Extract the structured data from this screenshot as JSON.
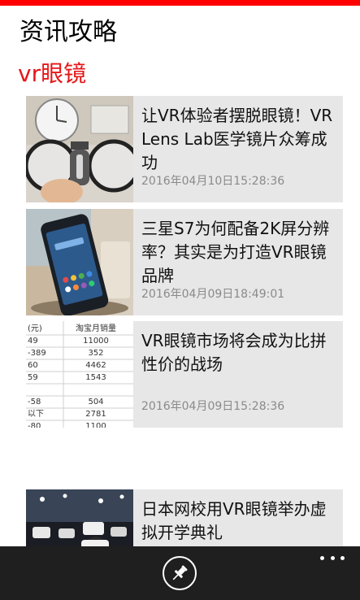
{
  "app": {
    "title": "资讯攻略"
  },
  "section": {
    "title": "vr眼镜"
  },
  "articles": [
    {
      "headline": "让VR体验者摆脱眼镜！VR Lens Lab医学镜片众筹成功",
      "time": "2016年04月10日15:28:36",
      "image": "glasses-lens-photo"
    },
    {
      "headline": "三星S7为何配备2K屏分辨率？其实是为打造VR眼镜品牌",
      "time": "2016年04月09日18:49:01",
      "image": "samsung-phone-photo"
    },
    {
      "headline": "VR眼镜市场将会成为比拼性价的战场",
      "time": "2016年04月09日15:28:36",
      "image": "sales-table-photo",
      "table": {
        "headers": [
          "(元)",
          "淘宝月销量"
        ],
        "rows": [
          [
            "49",
            "11000"
          ],
          [
            "-389",
            "352"
          ],
          [
            "60",
            "4462"
          ],
          [
            "59",
            "1543"
          ],
          [
            "",
            ""
          ],
          [
            "-58",
            "504"
          ],
          [
            "以下",
            "2781"
          ],
          [
            "-80",
            "1100"
          ]
        ]
      }
    },
    {
      "headline": "日本网校用VR眼镜举办虚拟开学典礼",
      "time": "",
      "image": "vr-ceremony-photo"
    }
  ],
  "appbar": {
    "pin_icon": "pin-icon",
    "more_icon": "more-dots-icon"
  },
  "colors": {
    "accent": "#ff0000",
    "section_title": "#e5171a",
    "card_bg": "#e7e7e7",
    "appbar_bg": "#1f1f1f"
  }
}
